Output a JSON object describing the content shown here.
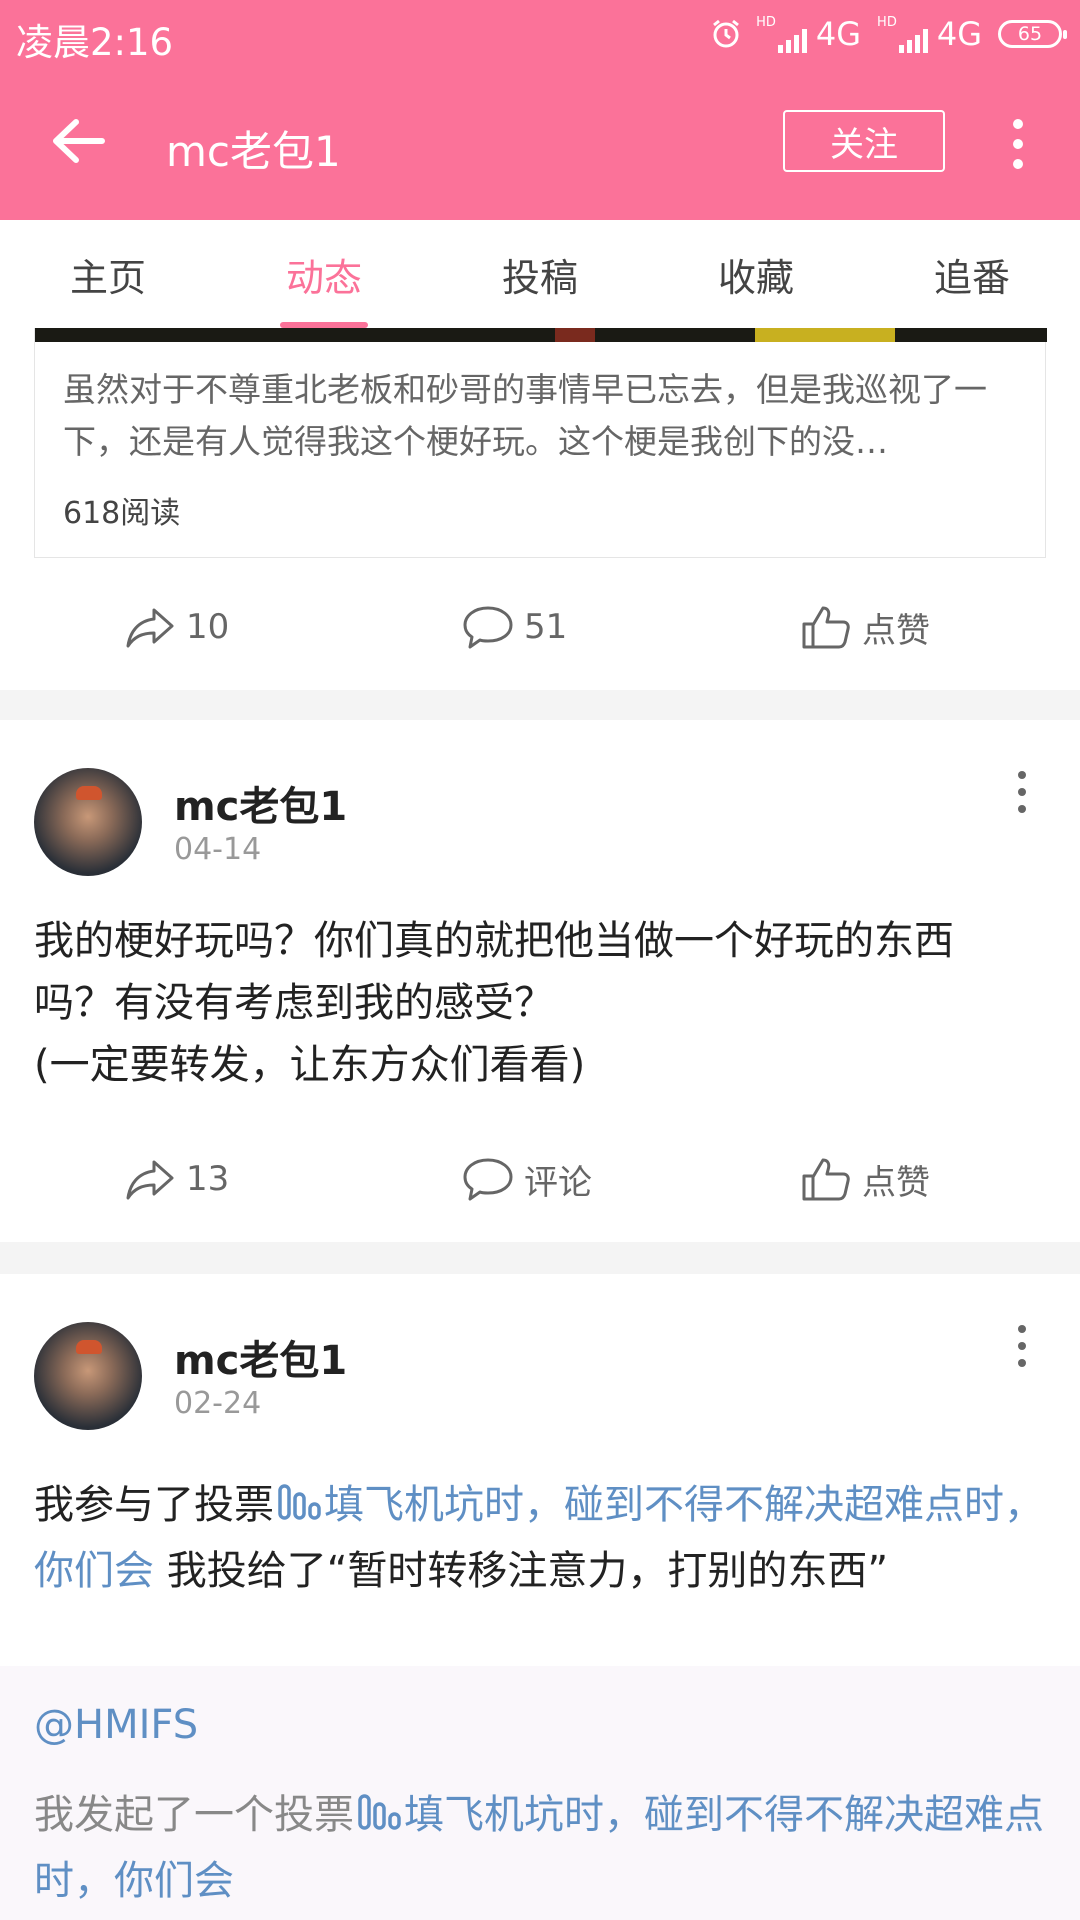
{
  "status_bar": {
    "time": "凌晨2:16",
    "network1": "4G",
    "network2": "4G",
    "hd_label": "HD",
    "battery": "65"
  },
  "app_bar": {
    "title": "mc老包1",
    "follow_label": "关注"
  },
  "tabs": [
    {
      "label": "主页",
      "active": false
    },
    {
      "label": "动态",
      "active": true
    },
    {
      "label": "投稿",
      "active": false
    },
    {
      "label": "收藏",
      "active": false
    },
    {
      "label": "追番",
      "active": false
    }
  ],
  "colors": {
    "accent": "#fb7299",
    "link": "#5f8fc4"
  },
  "post1": {
    "excerpt": "虽然对于不尊重北老板和砂哥的事情早已忘去，但是我巡视了一下，还是有人觉得我这个梗好玩。这个梗是我创下的没…",
    "reads": "618阅读",
    "share_count": "10",
    "comment_count": "51",
    "like_label": "点赞"
  },
  "post2": {
    "username": "mc老包1",
    "date": "04-14",
    "text_line1": "我的梗好玩吗？你们真的就把他当做一个好玩的东西",
    "text_line2": "吗？有没有考虑到我的感受？",
    "text_line3": "(一定要转发，让东方众们看看)",
    "share_count": "13",
    "comment_label": "评论",
    "like_label": "点赞"
  },
  "post3": {
    "username": "mc老包1",
    "date": "02-24",
    "prefix": "我参与了投票",
    "vote_title": "填飞机坑时，碰到不得不解决超难点时，你们会",
    "suffix": " 我投给了“暂时转移注意力，打别的东西”",
    "mention": "@HMIFS",
    "quote_prefix": "我发起了一个投票",
    "quote_vote_title": "填飞机坑时，碰到不得不解决超难点时，你们会"
  }
}
